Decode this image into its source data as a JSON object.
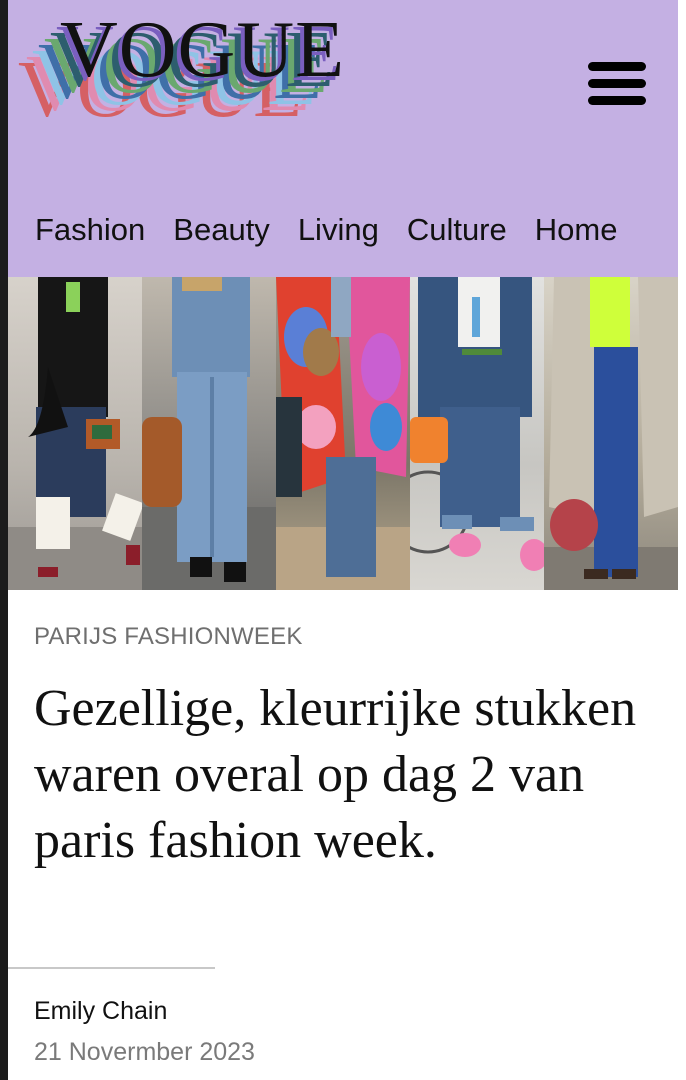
{
  "brand": {
    "logo_text": "VOGUE",
    "background": "#c4b0e3"
  },
  "header": {
    "menu_icon": "hamburger-menu-icon",
    "nav": [
      {
        "label": "Fashion"
      },
      {
        "label": "Beauty"
      },
      {
        "label": "Living"
      },
      {
        "label": "Culture"
      },
      {
        "label": "Home"
      }
    ]
  },
  "hero": {
    "description_panels": 5
  },
  "article": {
    "kicker": "PARIJS FASHIONWEEK",
    "headline": "Gezellige, kleurrijke stukken waren overal op dag 2 van paris fashion week.",
    "author": "Emily Chain",
    "date": "21 Novermber 2023"
  }
}
